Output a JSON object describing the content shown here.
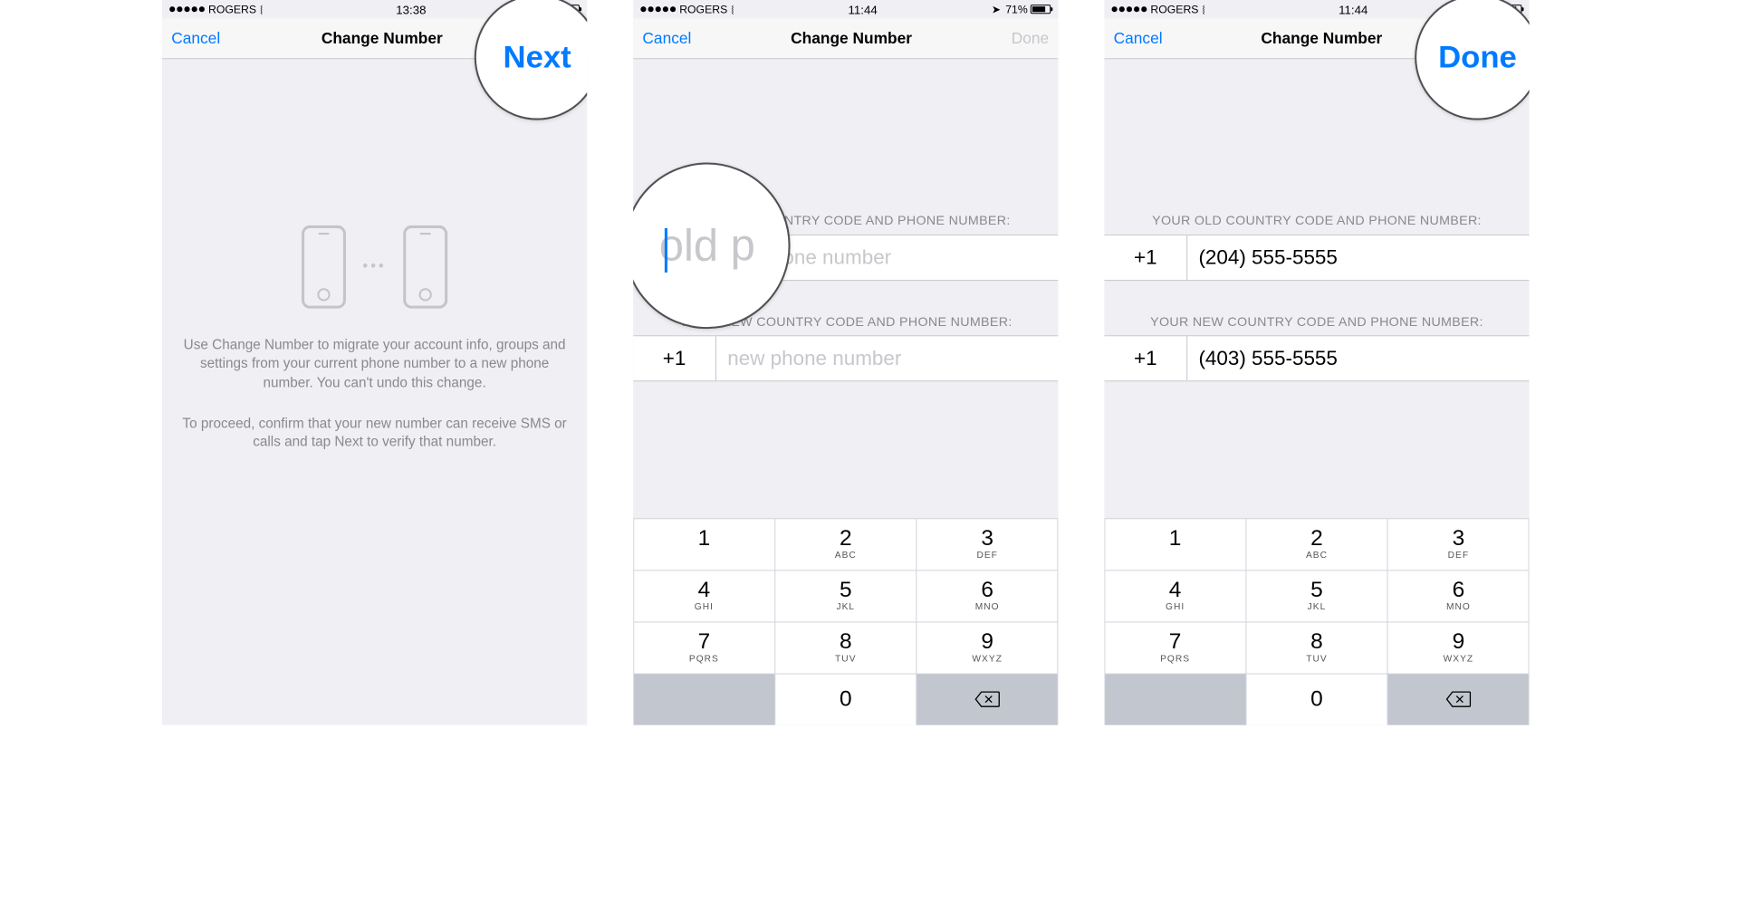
{
  "status": {
    "carrier": "ROGERS",
    "time1": "13:38",
    "time2": "11:44",
    "time3": "11:44",
    "battery_pct": "71%"
  },
  "nav": {
    "cancel": "Cancel",
    "title": "Change Number",
    "next": "Next",
    "done": "Done"
  },
  "intro": {
    "p1": "Use Change Number to migrate your account info, groups and settings from your current phone number to a new phone number. You can't undo this change.",
    "p2": "To proceed, confirm that your new number can receive SMS or calls and tap Next to verify that number."
  },
  "labels": {
    "old": "YOUR OLD COUNTRY CODE AND PHONE NUMBER:",
    "new": "YOUR NEW COUNTRY CODE AND PHONE NUMBER:"
  },
  "screen2": {
    "old_cc": "",
    "old_ph_placeholder": "old phone number",
    "new_cc": "+1",
    "new_ph_placeholder": "new phone number"
  },
  "screen3": {
    "old_cc": "+1",
    "old_ph": "(204) 555-5555",
    "new_cc": "+1",
    "new_ph": "(403) 555-5555"
  },
  "keys": {
    "k1": "1",
    "k2": "2",
    "k3": "3",
    "k4": "4",
    "k5": "5",
    "k6": "6",
    "k7": "7",
    "k8": "8",
    "k9": "9",
    "k0": "0",
    "s2": "ABC",
    "s3": "DEF",
    "s4": "GHI",
    "s5": "JKL",
    "s6": "MNO",
    "s7": "PQRS",
    "s8": "TUV",
    "s9": "WXYZ"
  },
  "highlight": {
    "input_zoom": "old p"
  }
}
